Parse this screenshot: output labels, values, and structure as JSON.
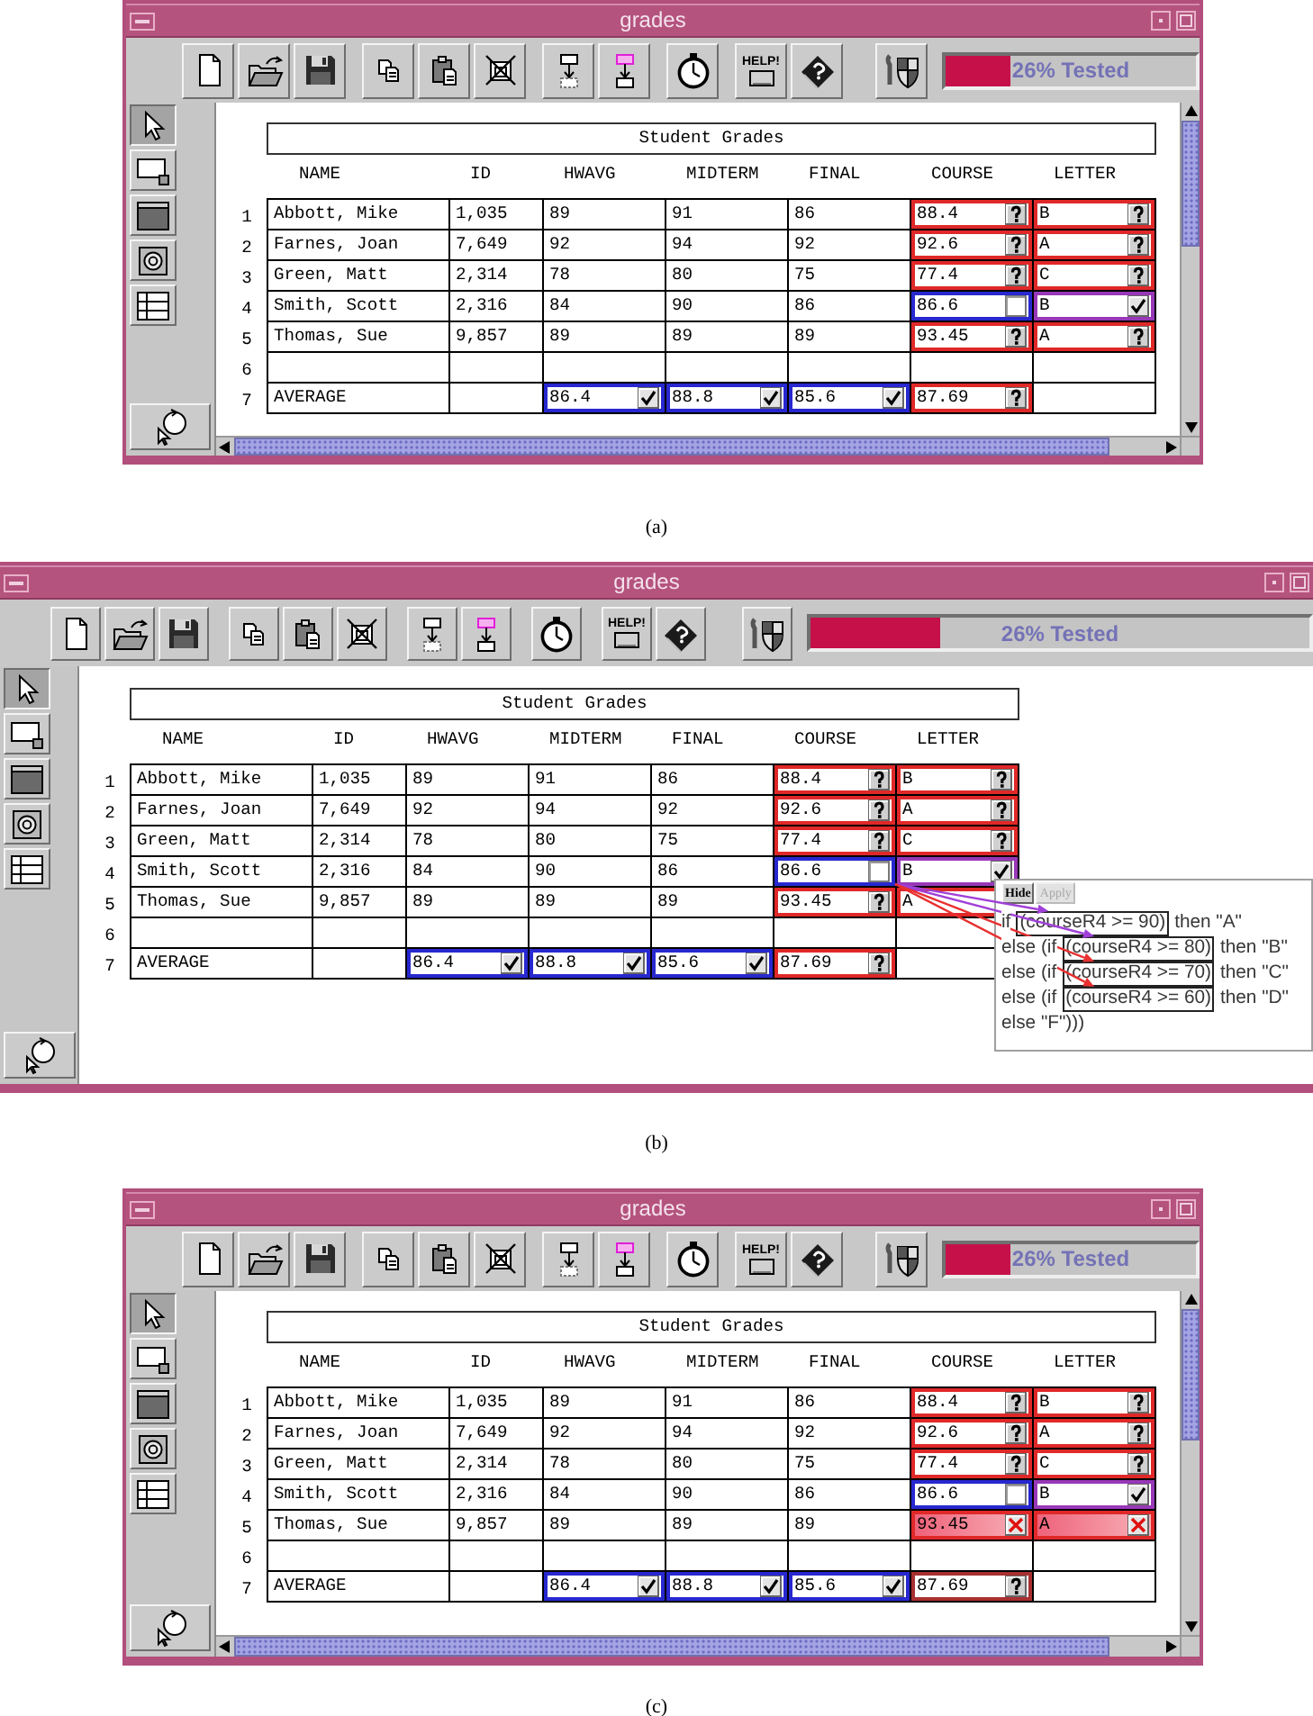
{
  "figures": [
    {
      "window": {
        "title": "grades"
      },
      "toolbar": {
        "help_label": "HELP!"
      },
      "progress": {
        "level": 0.26,
        "label": "26% Tested"
      },
      "palette": [
        {
          "kind": "pointer",
          "selected": true
        },
        {
          "kind": "cell",
          "selected": false
        },
        {
          "kind": "form",
          "selected": false
        },
        {
          "kind": "target",
          "selected": false
        },
        {
          "kind": "grid",
          "selected": false
        }
      ],
      "sheet": {
        "title": "Student Grades",
        "columns": [
          "NAME",
          "ID",
          "HWAVG",
          "MIDTERM",
          "FINAL",
          "COURSE",
          "LETTER"
        ],
        "rows": [
          {
            "number": "1",
            "cells": [
              {
                "value": "Abbott, Mike"
              },
              {
                "value": "1,035"
              },
              {
                "value": "89"
              },
              {
                "value": "91"
              },
              {
                "value": "86"
              },
              {
                "value": "88.4",
                "color": "#e02828",
                "kind": "question"
              },
              {
                "value": "B",
                "color": "#e02828",
                "kind": "question"
              }
            ]
          },
          {
            "number": "2",
            "cells": [
              {
                "value": "Farnes, Joan"
              },
              {
                "value": "7,649"
              },
              {
                "value": "92"
              },
              {
                "value": "94"
              },
              {
                "value": "92"
              },
              {
                "value": "92.6",
                "color": "#e02828",
                "kind": "question"
              },
              {
                "value": "A",
                "color": "#e02828",
                "kind": "question"
              }
            ]
          },
          {
            "number": "3",
            "cells": [
              {
                "value": "Green, Matt"
              },
              {
                "value": "2,314"
              },
              {
                "value": "78"
              },
              {
                "value": "80"
              },
              {
                "value": "75"
              },
              {
                "value": "77.4",
                "color": "#e02828",
                "kind": "question"
              },
              {
                "value": "C",
                "color": "#e02828",
                "kind": "question"
              }
            ]
          },
          {
            "number": "4",
            "cells": [
              {
                "value": "Smith, Scott"
              },
              {
                "value": "2,316"
              },
              {
                "value": "84"
              },
              {
                "value": "90"
              },
              {
                "value": "86"
              },
              {
                "value": "86.6",
                "color": "#2828d0",
                "kind": "unchecked"
              },
              {
                "value": "B",
                "color": "#9838b8",
                "kind": "checked"
              }
            ]
          },
          {
            "number": "5",
            "cells": [
              {
                "value": "Thomas, Sue"
              },
              {
                "value": "9,857"
              },
              {
                "value": "89"
              },
              {
                "value": "89"
              },
              {
                "value": "89"
              },
              {
                "value": "93.45",
                "color": "#e02828",
                "kind": "question"
              },
              {
                "value": "A",
                "color": "#e02828",
                "kind": "question"
              }
            ]
          },
          {
            "number": "6",
            "cells": [
              {},
              {},
              {},
              {},
              {},
              {},
              {}
            ]
          },
          {
            "number": "7",
            "cells": [
              {
                "value": "AVERAGE"
              },
              {},
              {
                "value": "86.4",
                "color": "#2828d0",
                "kind": "checked"
              },
              {
                "value": "88.8",
                "color": "#2828d0",
                "kind": "checked"
              },
              {
                "value": "85.6",
                "color": "#2828d0",
                "kind": "checked"
              },
              {
                "value": "87.69",
                "color": "#e02828",
                "kind": "question"
              },
              {}
            ]
          }
        ]
      },
      "scrollbars": true,
      "caption": "(a)"
    },
    {
      "window": {
        "title": "grades"
      },
      "toolbar": {
        "help_label": "HELP!"
      },
      "progress": {
        "level": 0.26,
        "label": "26% Tested"
      },
      "palette": [
        {
          "kind": "pointer",
          "selected": true
        },
        {
          "kind": "cell",
          "selected": false
        },
        {
          "kind": "form",
          "selected": false
        },
        {
          "kind": "target",
          "selected": false
        },
        {
          "kind": "grid",
          "selected": false
        }
      ],
      "sheet": {
        "title": "Student Grades",
        "columns": [
          "NAME",
          "ID",
          "HWAVG",
          "MIDTERM",
          "FINAL",
          "COURSE",
          "LETTER"
        ],
        "rows": [
          {
            "number": "1",
            "cells": [
              {
                "value": "Abbott, Mike"
              },
              {
                "value": "1,035"
              },
              {
                "value": "89"
              },
              {
                "value": "91"
              },
              {
                "value": "86"
              },
              {
                "value": "88.4",
                "color": "#e02828",
                "kind": "question"
              },
              {
                "value": "B",
                "color": "#e02828",
                "kind": "question"
              }
            ]
          },
          {
            "number": "2",
            "cells": [
              {
                "value": "Farnes, Joan"
              },
              {
                "value": "7,649"
              },
              {
                "value": "92"
              },
              {
                "value": "94"
              },
              {
                "value": "92"
              },
              {
                "value": "92.6",
                "color": "#e02828",
                "kind": "question"
              },
              {
                "value": "A",
                "color": "#e02828",
                "kind": "question"
              }
            ]
          },
          {
            "number": "3",
            "cells": [
              {
                "value": "Green, Matt"
              },
              {
                "value": "2,314"
              },
              {
                "value": "78"
              },
              {
                "value": "80"
              },
              {
                "value": "75"
              },
              {
                "value": "77.4",
                "color": "#e02828",
                "kind": "question"
              },
              {
                "value": "C",
                "color": "#e02828",
                "kind": "question"
              }
            ]
          },
          {
            "number": "4",
            "cells": [
              {
                "value": "Smith, Scott"
              },
              {
                "value": "2,316"
              },
              {
                "value": "84"
              },
              {
                "value": "90"
              },
              {
                "value": "86"
              },
              {
                "value": "86.6",
                "color": "#2828d0",
                "kind": "unchecked"
              },
              {
                "value": "B",
                "color": "#9838b8",
                "kind": "checked"
              }
            ]
          },
          {
            "number": "5",
            "cells": [
              {
                "value": "Thomas, Sue"
              },
              {
                "value": "9,857"
              },
              {
                "value": "89"
              },
              {
                "value": "89"
              },
              {
                "value": "89"
              },
              {
                "value": "93.45",
                "color": "#e02828",
                "kind": "question"
              },
              {
                "value": "A",
                "color": "#e02828"
              }
            ]
          },
          {
            "number": "6",
            "cells": [
              {},
              {},
              {},
              {},
              {},
              {},
              {}
            ]
          },
          {
            "number": "7",
            "cells": [
              {
                "value": "AVERAGE"
              },
              {},
              {
                "value": "86.4",
                "color": "#2828d0",
                "kind": "checked"
              },
              {
                "value": "88.8",
                "color": "#2828d0",
                "kind": "checked"
              },
              {
                "value": "85.6",
                "color": "#2828d0",
                "kind": "checked"
              },
              {
                "value": "87.69",
                "color": "#e02828",
                "kind": "question"
              },
              {}
            ]
          }
        ]
      },
      "popup": {
        "buttons": [
          {
            "label": "Hide",
            "disabled": false
          },
          {
            "label": "Apply",
            "disabled": true
          }
        ],
        "lines": [
          {
            "parts": [
              {
                "text": "if",
                "boxed": false
              },
              {
                "text": "(courseR4 >= 90)",
                "boxed": true
              },
              {
                "text": "then \"A\"",
                "boxed": false
              }
            ]
          },
          {
            "parts": [
              {
                "text": "else (if",
                "boxed": false
              },
              {
                "text": "(courseR4 >= 80)",
                "boxed": true
              },
              {
                "text": "then \"B\"",
                "boxed": false
              }
            ]
          },
          {
            "parts": [
              {
                "text": "else (if",
                "boxed": false
              },
              {
                "text": "(courseR4 >= 70)",
                "boxed": true
              },
              {
                "text": "then \"C\"",
                "boxed": false
              }
            ]
          },
          {
            "parts": [
              {
                "text": "else (if",
                "boxed": false
              },
              {
                "text": "(courseR4 >= 60)",
                "boxed": true
              },
              {
                "text": "then \"D\"",
                "boxed": false
              }
            ]
          },
          {
            "parts": [
              {
                "text": "else \"F\")))",
                "boxed": false
              }
            ]
          }
        ],
        "arrows": [
          {
            "color": "#a040d8"
          },
          {
            "color": "#a040d8"
          },
          {
            "color": "#e83030"
          },
          {
            "color": "#e83030"
          }
        ]
      },
      "caption": "(b)"
    },
    {
      "window": {
        "title": "grades"
      },
      "toolbar": {
        "help_label": "HELP!"
      },
      "progress": {
        "level": 0.26,
        "label": "26% Tested"
      },
      "palette": [
        {
          "kind": "pointer",
          "selected": true
        },
        {
          "kind": "cell",
          "selected": false
        },
        {
          "kind": "form",
          "selected": false
        },
        {
          "kind": "target",
          "selected": false
        },
        {
          "kind": "grid",
          "selected": false
        }
      ],
      "sheet": {
        "title": "Student Grades",
        "columns": [
          "NAME",
          "ID",
          "HWAVG",
          "MIDTERM",
          "FINAL",
          "COURSE",
          "LETTER"
        ],
        "rows": [
          {
            "number": "1",
            "cells": [
              {
                "value": "Abbott, Mike"
              },
              {
                "value": "1,035"
              },
              {
                "value": "89"
              },
              {
                "value": "91"
              },
              {
                "value": "86"
              },
              {
                "value": "88.4",
                "color": "#e02828",
                "kind": "question"
              },
              {
                "value": "B",
                "color": "#e02828",
                "kind": "question"
              }
            ]
          },
          {
            "number": "2",
            "cells": [
              {
                "value": "Farnes, Joan"
              },
              {
                "value": "7,649"
              },
              {
                "value": "92"
              },
              {
                "value": "94"
              },
              {
                "value": "92"
              },
              {
                "value": "92.6",
                "color": "#e02828",
                "kind": "question"
              },
              {
                "value": "A",
                "color": "#e02828",
                "kind": "question"
              }
            ]
          },
          {
            "number": "3",
            "cells": [
              {
                "value": "Green, Matt"
              },
              {
                "value": "2,314"
              },
              {
                "value": "78"
              },
              {
                "value": "80"
              },
              {
                "value": "75"
              },
              {
                "value": "77.4",
                "color": "#e02828",
                "kind": "question"
              },
              {
                "value": "C",
                "color": "#e02828",
                "kind": "question"
              }
            ]
          },
          {
            "number": "4",
            "cells": [
              {
                "value": "Smith, Scott"
              },
              {
                "value": "2,316"
              },
              {
                "value": "84"
              },
              {
                "value": "90"
              },
              {
                "value": "86"
              },
              {
                "value": "86.6",
                "color": "#2828d0",
                "kind": "unchecked"
              },
              {
                "value": "B",
                "color": "#9838b8",
                "kind": "checked"
              }
            ]
          },
          {
            "number": "5",
            "cells": [
              {
                "value": "Thomas, Sue"
              },
              {
                "value": "9,857"
              },
              {
                "value": "89"
              },
              {
                "value": "89"
              },
              {
                "value": "89"
              },
              {
                "value": "93.45",
                "color": "#e02828",
                "kind": "failed"
              },
              {
                "value": "A",
                "color": "#e02828",
                "kind": "failed"
              }
            ]
          },
          {
            "number": "6",
            "cells": [
              {},
              {},
              {},
              {},
              {},
              {},
              {}
            ]
          },
          {
            "number": "7",
            "cells": [
              {
                "value": "AVERAGE"
              },
              {},
              {
                "value": "86.4",
                "color": "#2828d0",
                "kind": "checked"
              },
              {
                "value": "88.8",
                "color": "#2828d0",
                "kind": "checked"
              },
              {
                "value": "85.6",
                "color": "#2828d0",
                "kind": "checked"
              },
              {
                "value": "87.69",
                "color": "#a83030",
                "kind": "question"
              },
              {}
            ]
          }
        ]
      },
      "scrollbars": true,
      "caption": "(c)"
    }
  ]
}
